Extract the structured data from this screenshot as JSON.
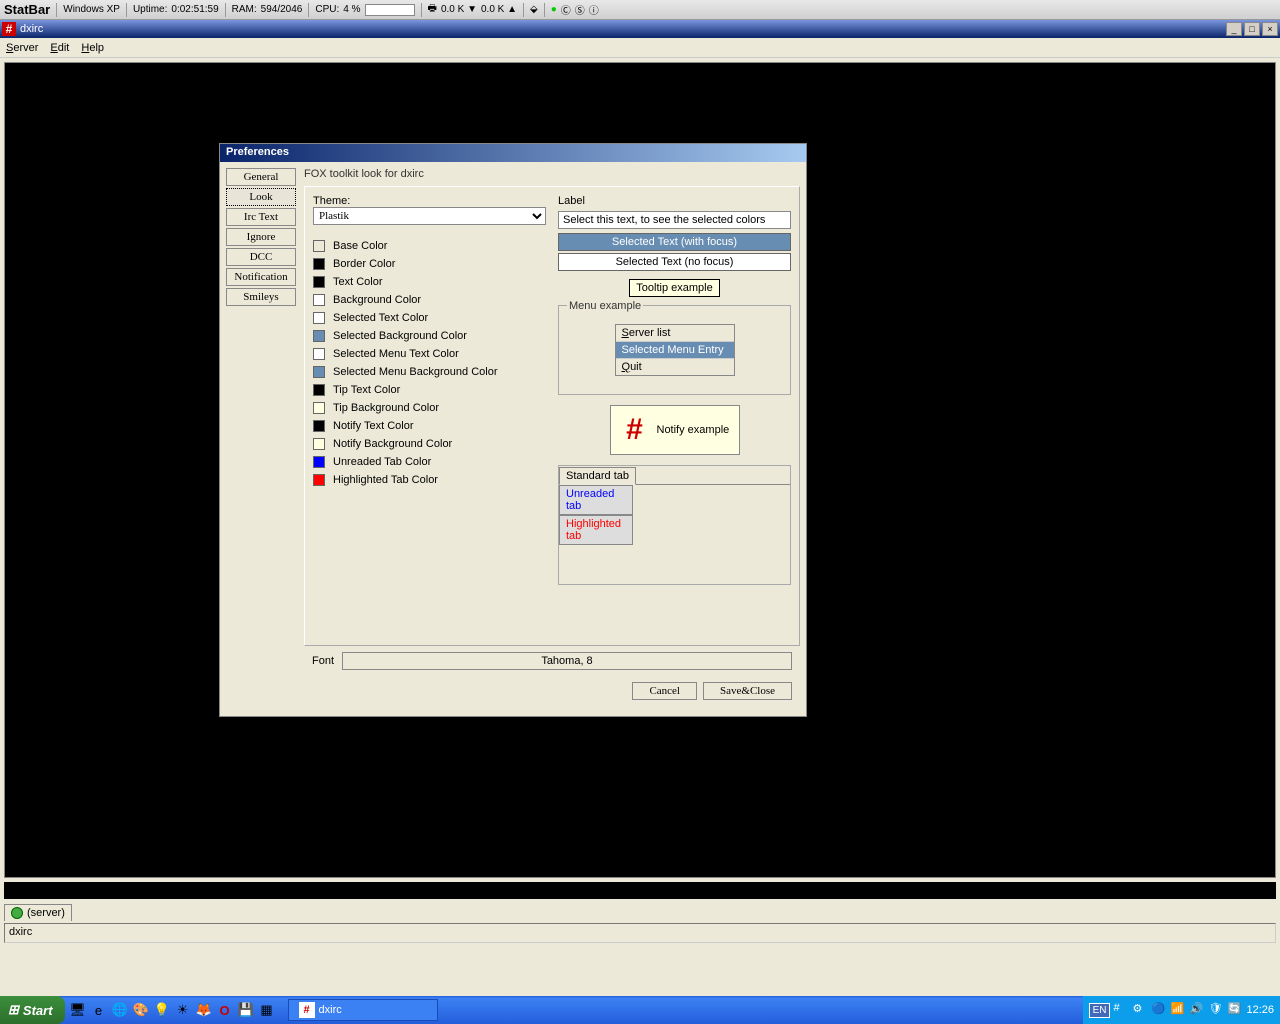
{
  "statbar": {
    "brand": "StatBar",
    "os": "Windows XP",
    "uptime_label": "Uptime:",
    "uptime_value": "0:02:51:59",
    "ram_label": "RAM:",
    "ram_value": "594/2046",
    "cpu_label": "CPU:",
    "cpu_value": "4 %",
    "net_down": "0.0 K ▼",
    "net_up": "0.0 K ▲"
  },
  "window": {
    "title": "dxirc",
    "min": "_",
    "max": "□",
    "close": "×"
  },
  "menubar": {
    "server": "Server",
    "edit": "Edit",
    "help": "Help"
  },
  "prefs": {
    "title": "Preferences",
    "tabs": {
      "general": "General",
      "look": "Look",
      "irctext": "Irc Text",
      "ignore": "Ignore",
      "dcc": "DCC",
      "notification": "Notification",
      "smileys": "Smileys"
    },
    "desc": "FOX toolkit look for dxirc",
    "theme_label": "Theme:",
    "theme_value": "Plastik",
    "colors": {
      "base": "Base Color",
      "border": "Border Color",
      "text": "Text Color",
      "background": "Background Color",
      "seltext": "Selected Text Color",
      "selbg": "Selected Background Color",
      "selmenu": "Selected Menu Text Color",
      "selmenubg": "Selected Menu Background Color",
      "tiptext": "Tip Text Color",
      "tipbg": "Tip Background Color",
      "notifytext": "Notify Text Color",
      "notifybg": "Notify Background Color",
      "unreadtab": "Unreaded Tab Color",
      "hilighttab": "Highlighted Tab Color"
    },
    "swatches": {
      "base": "#ece9d8",
      "border": "#000000",
      "text": "#000000",
      "background": "#ffffff",
      "seltext": "#ffffff",
      "selbg": "#678db2",
      "selmenu": "#ffffff",
      "selmenubg": "#678db2",
      "tiptext": "#000000",
      "tipbg": "#ffffe1",
      "notifytext": "#000000",
      "notifybg": "#ffffe1",
      "unreadtab": "#0000ff",
      "hilighttab": "#ff0000"
    },
    "preview": {
      "label_heading": "Label",
      "label_text": "Select this text, to see the selected colors",
      "sel_focus": "Selected Text (with focus)",
      "sel_nofocus": "Selected Text (no focus)",
      "tooltip": "Tooltip example",
      "menu_heading": "Menu example",
      "menu_items": {
        "serverlist": "Server list",
        "selentry": "Selected Menu Entry",
        "quit": "Quit"
      },
      "notify": "Notify example",
      "tabs": {
        "std": "Standard tab",
        "unr": "Unreaded tab",
        "hil": "Highlighted tab"
      }
    },
    "font_label": "Font",
    "font_value": "Tahoma, 8",
    "cancel": "Cancel",
    "saveclose": "Save&Close"
  },
  "servertab": "(server)",
  "statusbar": "dxirc",
  "taskbar": {
    "start": "Start",
    "task": "dxirc",
    "lang": "EN",
    "clock": "12:26"
  }
}
